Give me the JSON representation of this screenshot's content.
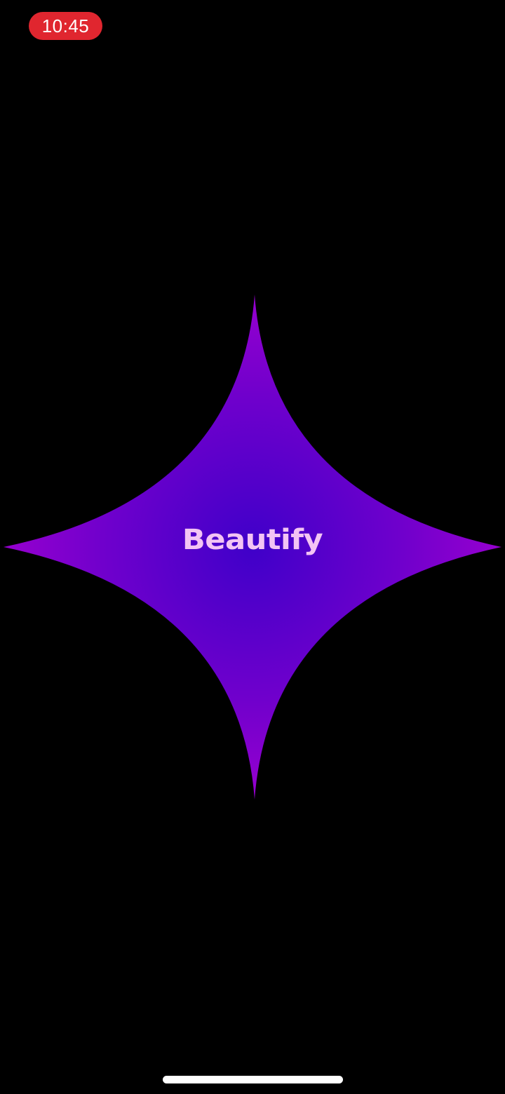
{
  "status_bar": {
    "time": "10:45"
  },
  "splash": {
    "app_name": "Beautify",
    "shape": "four-point-sparkle",
    "colors": {
      "center": "#3f00c9",
      "edge": "#9a00cf",
      "text": "#f3c4f4",
      "background": "#000000",
      "time_pill": "#e0262f"
    }
  }
}
